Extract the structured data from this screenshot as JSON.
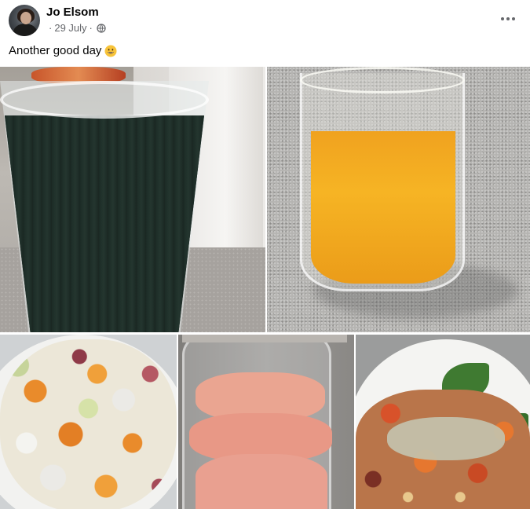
{
  "post": {
    "author": "Jo Elsom",
    "date": "29 July",
    "separator": "·",
    "audience_icon": "globe-icon",
    "text": "Another good day",
    "emoji": "grinning-face-icon",
    "more_icon": "more-options-icon"
  },
  "photos": [
    {
      "subject": "green-smoothie-photo"
    },
    {
      "subject": "orange-juice-photo"
    },
    {
      "subject": "salad-photo"
    },
    {
      "subject": "pink-smoothie-photo"
    },
    {
      "subject": "roasted-vegetable-bowl-photo"
    }
  ]
}
